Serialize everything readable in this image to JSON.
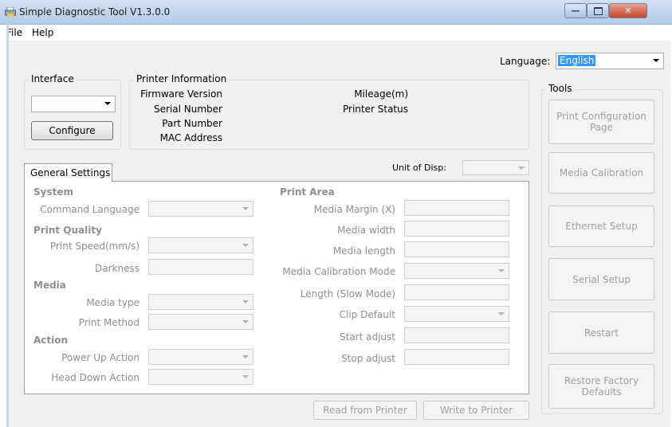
{
  "window": {
    "title": "Simple Diagnostic Tool V1.3.0.0",
    "icon": "printer-app-icon",
    "controls": {
      "minimize": "minimize-icon",
      "maximize": "maximize-icon",
      "close": "close-icon"
    }
  },
  "menu": {
    "file": "File",
    "help": "Help"
  },
  "language": {
    "label": "Language:",
    "value": "English"
  },
  "interface": {
    "title": "Interface",
    "value": "",
    "configure_button": "Configure"
  },
  "printer_info": {
    "title": "Printer Information",
    "left_fields": [
      "Firmware Version",
      "Serial Number",
      "Part Number",
      "MAC Address"
    ],
    "right_fields": [
      "Mileage(m)",
      "Printer Status"
    ]
  },
  "unit_of_display": {
    "label": "Unit of Disp:",
    "value": ""
  },
  "tab": {
    "label": "General Settings"
  },
  "settings": {
    "system": {
      "heading": "System",
      "command_language": "Command Language"
    },
    "print_quality": {
      "heading": "Print Quality",
      "print_speed": "Print Speed(mm/s)",
      "darkness": "Darkness"
    },
    "media": {
      "heading": "Media",
      "media_type": "Media type",
      "print_method": "Print Method"
    },
    "action": {
      "heading": "Action",
      "power_up_action": "Power Up Action",
      "head_down_action": "Head Down Action"
    },
    "print_area": {
      "heading": "Print Area",
      "media_margin_x": "Media Margin (X)",
      "media_width": "Media width",
      "media_length": "Media length",
      "media_calibration_mode": "Media Calibration Mode",
      "length_slow_mode": "Length (Slow Mode)",
      "clip_default": "Clip Default",
      "start_adjust": "Start adjust",
      "stop_adjust": "Stop adjust"
    }
  },
  "bottom_buttons": {
    "read": "Read from Printer",
    "write": "Write to Printer"
  },
  "tools": {
    "title": "Tools",
    "buttons": [
      "Print Configuration Page",
      "Media Calibration",
      "Ethernet Setup",
      "Serial Setup",
      "Restart",
      "Restore Factory Defaults"
    ]
  }
}
